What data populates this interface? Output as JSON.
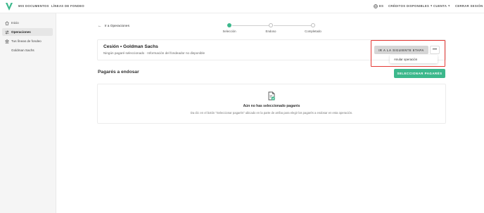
{
  "topbar": {
    "nav": [
      "MIS DOCUMENTOS",
      "LÍNEAS DE FONDEO"
    ],
    "language": "ES",
    "credits": "CRÉDITOS DISPONIBLES",
    "account": "CUENTA",
    "logout": "CERRAR SESIÓN"
  },
  "sidebar": {
    "items": [
      {
        "label": "Inicio",
        "icon": "home-icon"
      },
      {
        "label": "Operaciones",
        "icon": "arrows-icon"
      },
      {
        "label": "Tus líneas de fondeo",
        "icon": "bank-icon"
      },
      {
        "label": "Goldman Sachs",
        "icon": ""
      }
    ]
  },
  "main": {
    "back": "Ir a Operaciones",
    "steps": [
      "Selección",
      "Endoso",
      "Completado"
    ],
    "operation_title": "Cesión • Goldman Sachs",
    "operation_subtitle": "Ningún pagaré seleccionado · Información del fondeador no disponible",
    "next_button": "IR A LA SIGUIENTE ETAPA",
    "more_button": "•••",
    "dropdown_item": "Anular operación",
    "section_title": "Pagarés a endosar",
    "select_button": "SELECCIONAR PAGARÉS",
    "empty_title": "Aún no has seleccionado pagarés",
    "empty_desc": "Da clic en el botón \"Seleccionar pagarés\" ubicado en la parte de arriba para elegir los pagarés a endosar en esta operación."
  },
  "colors": {
    "brand": "#3cb88c",
    "highlight": "#e53935"
  }
}
